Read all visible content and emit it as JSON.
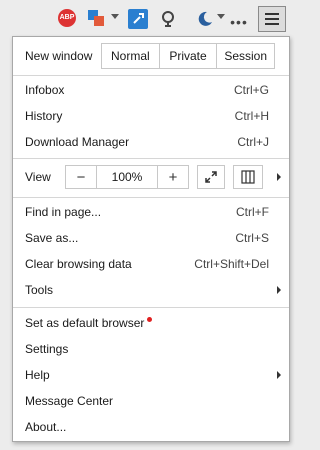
{
  "toolbar": {
    "abp_label": "ABP",
    "icons": [
      "adblock-icon",
      "translate-icon",
      "extension-icon",
      "zoom-icon",
      "night-mode-icon",
      "more-icon",
      "menu-icon"
    ]
  },
  "menu": {
    "new_window": {
      "label": "New window",
      "options": [
        "Normal",
        "Private",
        "Session"
      ]
    },
    "items_a": [
      {
        "label": "Infobox",
        "shortcut": "Ctrl+G"
      },
      {
        "label": "History",
        "shortcut": "Ctrl+H"
      },
      {
        "label": "Download Manager",
        "shortcut": "Ctrl+J"
      }
    ],
    "view": {
      "label": "View",
      "zoom_out": "−",
      "zoom_value": "100%",
      "zoom_in": "+"
    },
    "items_b": [
      {
        "label": "Find in page...",
        "shortcut": "Ctrl+F"
      },
      {
        "label": "Save as...",
        "shortcut": "Ctrl+S"
      },
      {
        "label": "Clear browsing data",
        "shortcut": "Ctrl+Shift+Del"
      },
      {
        "label": "Tools",
        "shortcut": ""
      }
    ],
    "items_c": [
      {
        "label": "Set as default browser"
      },
      {
        "label": "Settings"
      },
      {
        "label": "Help"
      },
      {
        "label": "Message Center"
      },
      {
        "label": "About..."
      }
    ]
  }
}
